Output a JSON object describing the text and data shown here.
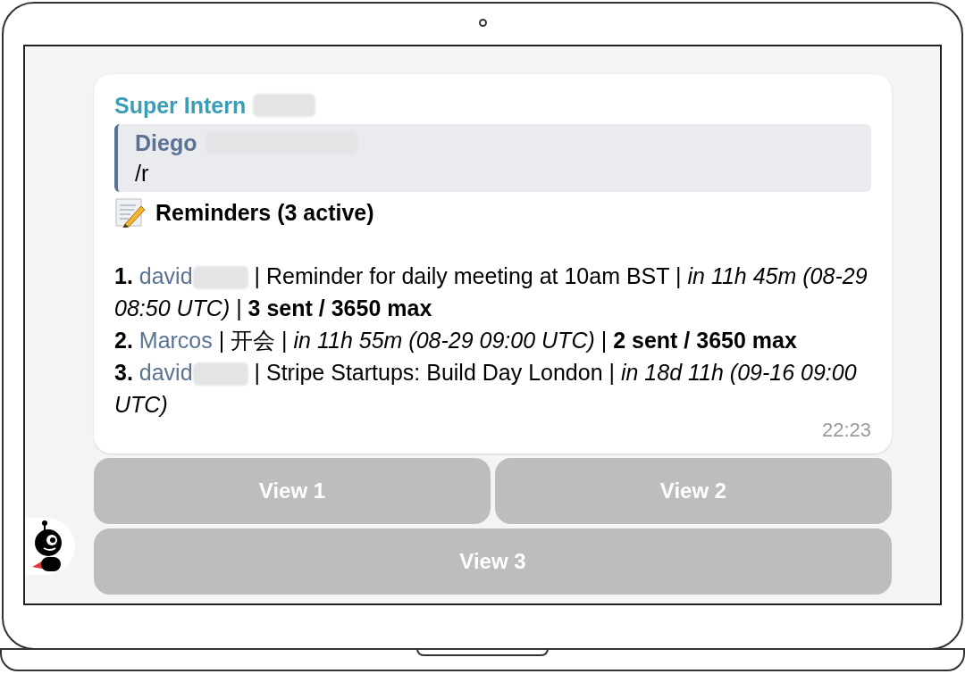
{
  "message": {
    "sender": {
      "name": "Super Intern",
      "redacted": true
    },
    "reply": {
      "name": "Diego",
      "redacted": true,
      "text": "/r"
    },
    "heading": "Reminders (3 active)",
    "reminders": [
      {
        "number": "1.",
        "user": "david",
        "redacted": true,
        "details": "| Reminder for daily meeting at 10am BST | *in 11h 45m (08-29 08:50 UTC)* | **3 sent / 3650 max**"
      },
      {
        "number": "2.",
        "user": "Marcos",
        "redacted": false,
        "details": "| 开会 | *in 11h 55m (08-29 09:00 UTC)* | **2 sent / 3650 max**"
      },
      {
        "number": "3.",
        "user": "david",
        "redacted": true,
        "details": "| Stripe Startups: Build Day London | *in 18d 11h (09-16 09:00 UTC)*"
      }
    ],
    "time": "22:23"
  },
  "buttons": [
    [
      "View 1",
      "View 2"
    ],
    [
      "View 3"
    ]
  ]
}
